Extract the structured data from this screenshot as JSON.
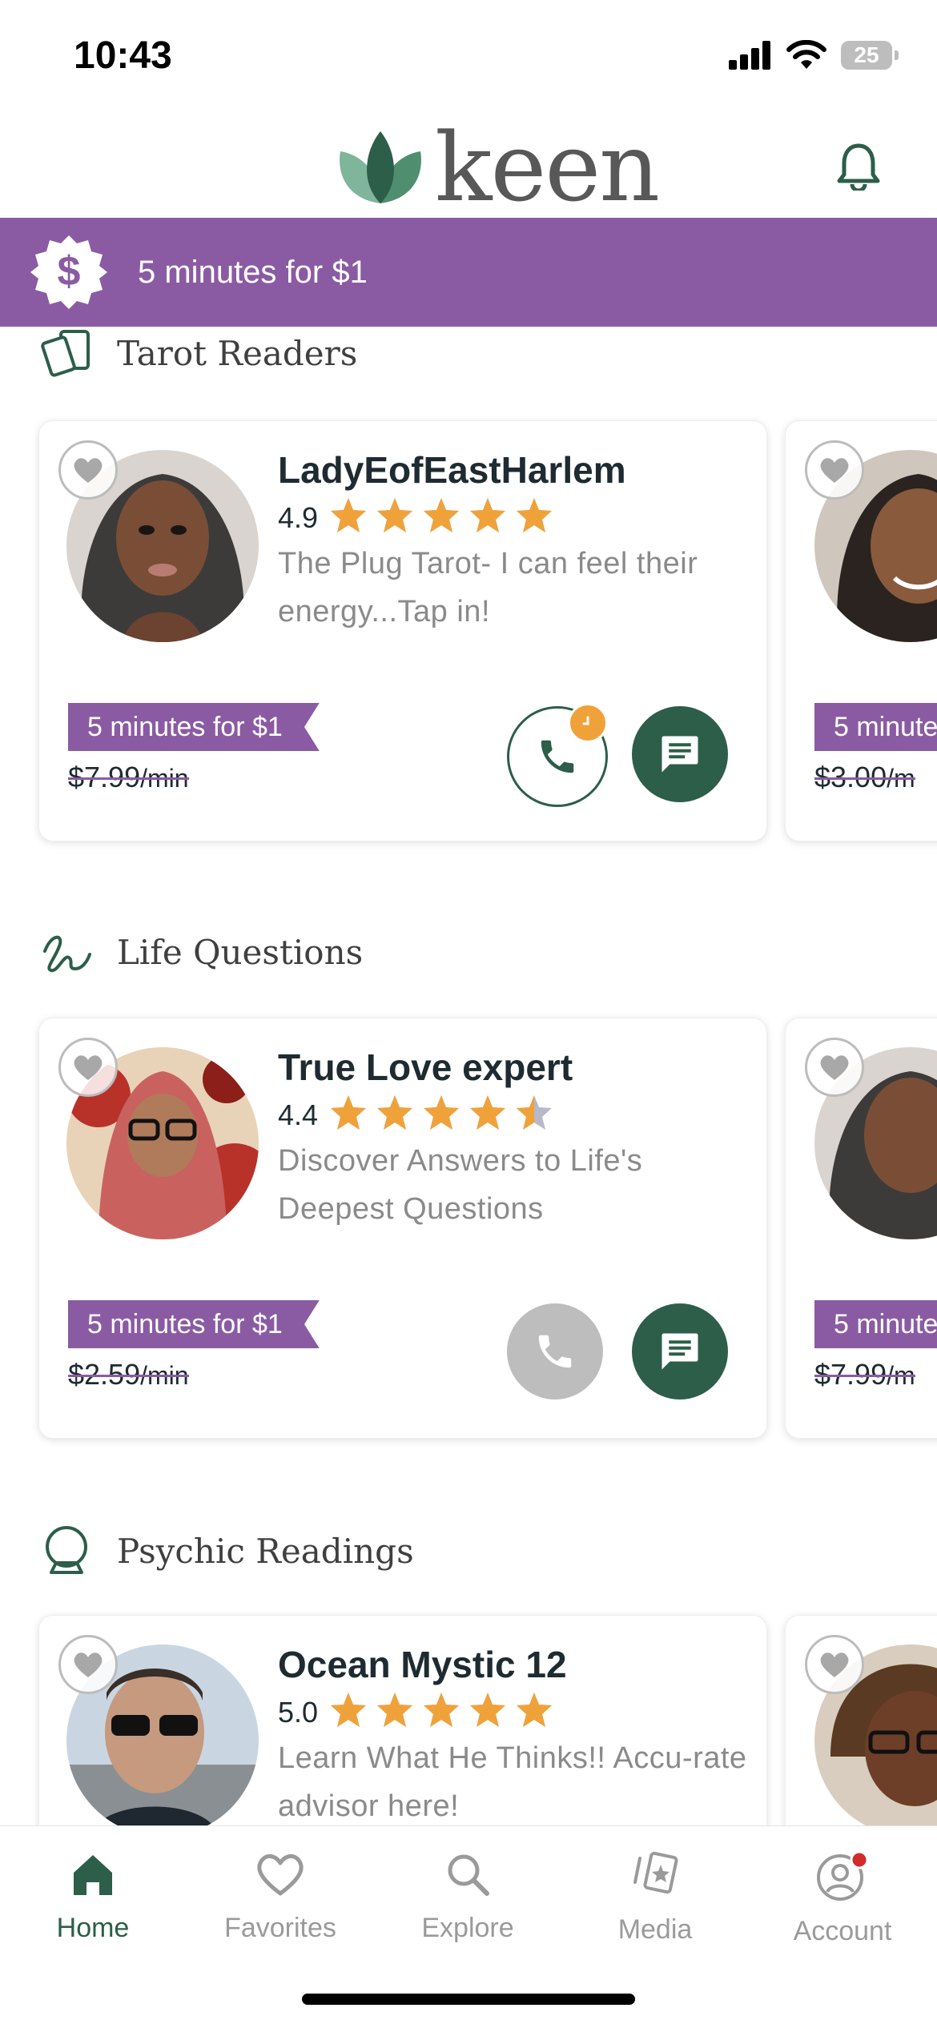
{
  "status_bar": {
    "time": "10:43",
    "battery": "25"
  },
  "header": {
    "logo_text": "keen"
  },
  "promo_banner": {
    "text": "5 minutes for $1"
  },
  "sections": [
    {
      "title": "Tarot Readers",
      "advisor": {
        "name": "LadyEofEastHarlem",
        "rating": "4.9",
        "stars": 5,
        "description": "The Plug Tarot- I can feel their energy...Tap in!",
        "promo": "5 minutes for $1",
        "price": "$7.99",
        "unit": "/min",
        "call_available": true
      },
      "peek": {
        "promo": "5 minute",
        "price": "$3.00",
        "unit": "/m"
      }
    },
    {
      "title": "Life Questions",
      "advisor": {
        "name": "True Love expert",
        "rating": "4.4",
        "stars": 4.5,
        "description": "Discover Answers to Life's Deepest Questions",
        "promo": "5 minutes for $1",
        "price": "$2.59",
        "unit": "/min",
        "call_available": false
      },
      "peek": {
        "promo": "5 minute",
        "price": "$7.99",
        "unit": "/m"
      }
    },
    {
      "title": "Psychic Readings",
      "advisor": {
        "name": "Ocean Mystic 12",
        "rating": "5.0",
        "stars": 5,
        "description": "Learn What He Thinks!! Accu-rate advisor here!"
      }
    }
  ],
  "nav": [
    {
      "label": "Home",
      "icon": "home-icon",
      "active": true
    },
    {
      "label": "Favorites",
      "icon": "heart-icon",
      "active": false
    },
    {
      "label": "Explore",
      "icon": "search-icon",
      "active": false
    },
    {
      "label": "Media",
      "icon": "cards-icon",
      "active": false
    },
    {
      "label": "Account",
      "icon": "account-icon",
      "active": false
    }
  ],
  "colors": {
    "brand_green": "#2c5e4a",
    "promo_purple": "#8a5ba3",
    "star": "#f0a23a"
  }
}
